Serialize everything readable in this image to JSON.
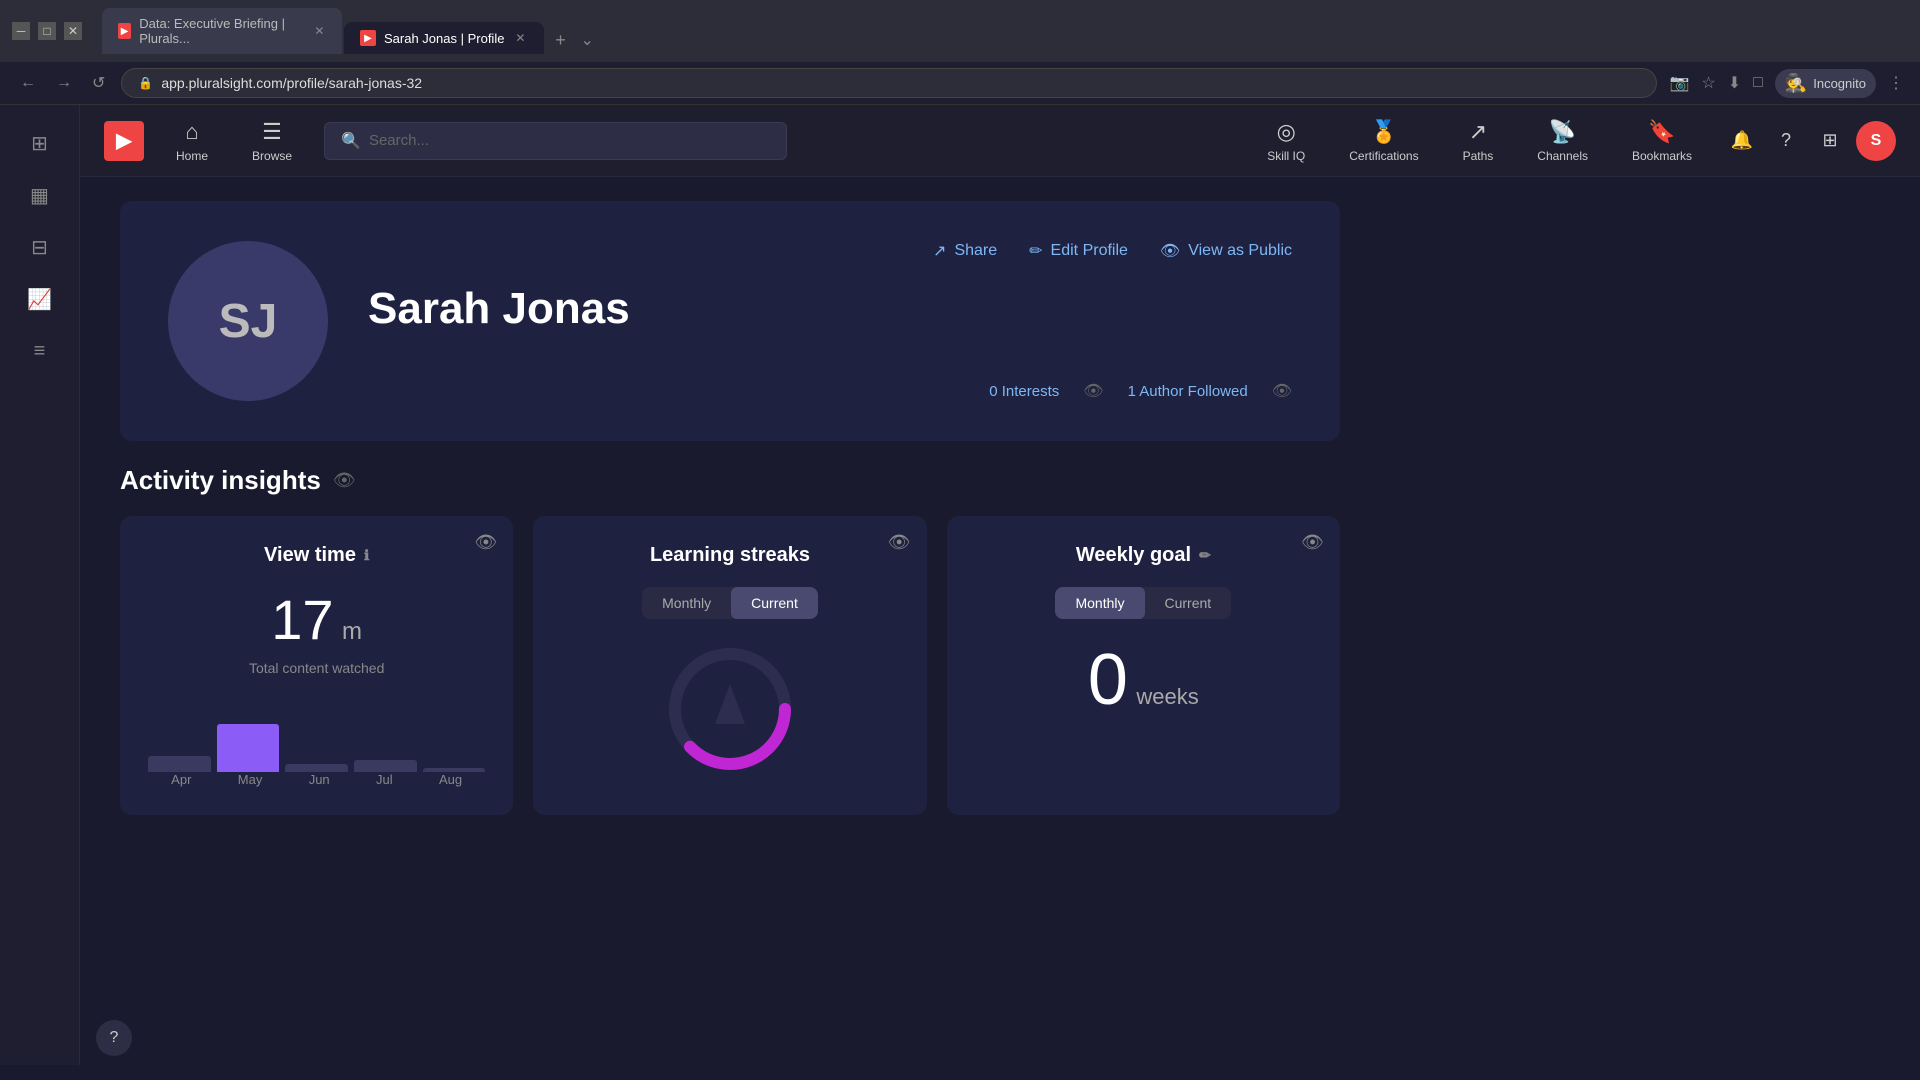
{
  "browser": {
    "tabs": [
      {
        "id": "tab-1",
        "label": "Data: Executive Briefing | Plurals...",
        "favicon": "▶",
        "favicon_bg": "#e44",
        "active": false
      },
      {
        "id": "tab-2",
        "label": "Sarah Jonas | Profile",
        "favicon": "▶",
        "favicon_bg": "#e44",
        "active": true
      }
    ],
    "url": "app.pluralsight.com/profile/sarah-jonas-32",
    "incognito_label": "Incognito"
  },
  "nav": {
    "logo": "▶",
    "search_placeholder": "Search...",
    "items": [
      {
        "id": "home",
        "icon": "⌂",
        "label": "Home"
      },
      {
        "id": "browse",
        "icon": "☰",
        "label": "Browse"
      },
      {
        "id": "skill-iq",
        "icon": "◎",
        "label": "Skill IQ"
      },
      {
        "id": "certifications",
        "icon": "🏅",
        "label": "Certifications"
      },
      {
        "id": "paths",
        "icon": "↗",
        "label": "Paths"
      },
      {
        "id": "channels",
        "icon": "📡",
        "label": "Channels"
      },
      {
        "id": "bookmarks",
        "icon": "🔖",
        "label": "Bookmarks"
      }
    ],
    "avatar_initials": "S"
  },
  "sidebar": {
    "items": [
      {
        "id": "grid",
        "icon": "⊞"
      },
      {
        "id": "chart-bar",
        "icon": "▦"
      },
      {
        "id": "table",
        "icon": "⊟"
      },
      {
        "id": "chart-line",
        "icon": "📈"
      },
      {
        "id": "list",
        "icon": "≡"
      }
    ]
  },
  "profile": {
    "name": "Sarah Jonas",
    "initials": "SJ",
    "share_label": "Share",
    "edit_label": "Edit Profile",
    "view_public_label": "View as Public",
    "interests_label": "0 Interests",
    "author_followed_label": "1 Author Followed"
  },
  "activity": {
    "title": "Activity insights",
    "view_time_card": {
      "title": "View time",
      "time_value": "17",
      "time_unit": "m",
      "time_label": "Total content watched",
      "months": [
        "Apr",
        "May",
        "Jun",
        "Jul",
        "Aug"
      ]
    },
    "streaks_card": {
      "title": "Learning streaks",
      "toggle_monthly": "Monthly",
      "toggle_current": "Current",
      "active_toggle": "Current"
    },
    "weekly_card": {
      "title": "Weekly goal",
      "value": "0",
      "unit": "weeks",
      "toggle_monthly": "Monthly",
      "toggle_current": "Current",
      "active_toggle": "Monthly"
    }
  }
}
